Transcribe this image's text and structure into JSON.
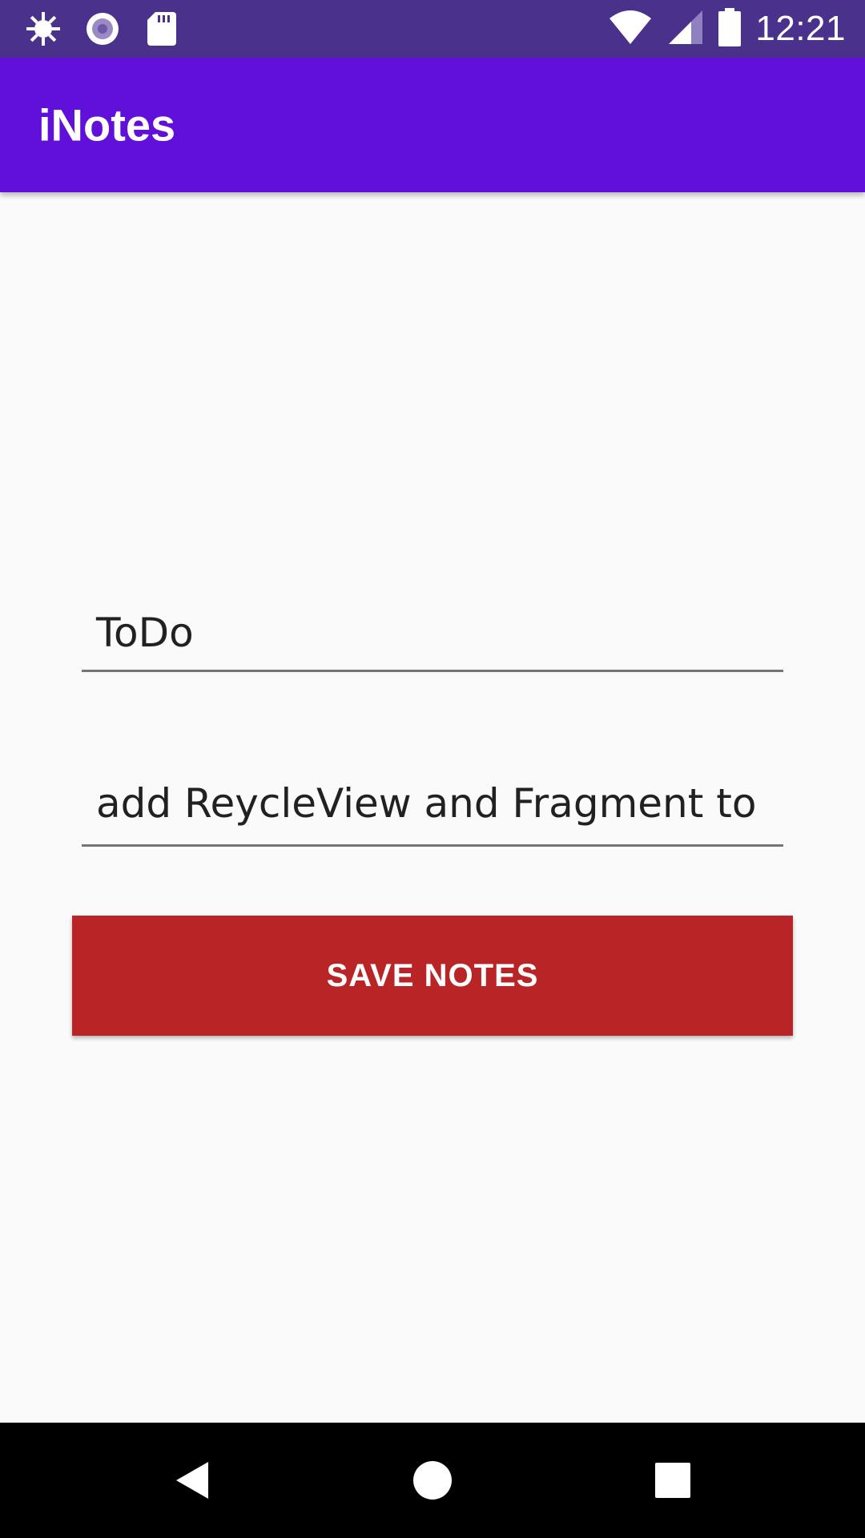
{
  "status_bar": {
    "time": "12:21",
    "left_icons": [
      "settings-burst-icon",
      "record-icon",
      "sd-card-icon"
    ],
    "right_icons": [
      "wifi-icon",
      "cell-signal-icon",
      "battery-icon"
    ],
    "background": "#4a328c"
  },
  "app_bar": {
    "title": "iNotes",
    "background": "#6010d8"
  },
  "form": {
    "title_value": "ToDo",
    "body_value": "add ReycleView and Fragment to",
    "save_label": "SAVE NOTES",
    "save_color": "#b92526"
  },
  "nav_bar": {
    "icons": [
      "back-icon",
      "home-icon",
      "recents-icon"
    ]
  }
}
